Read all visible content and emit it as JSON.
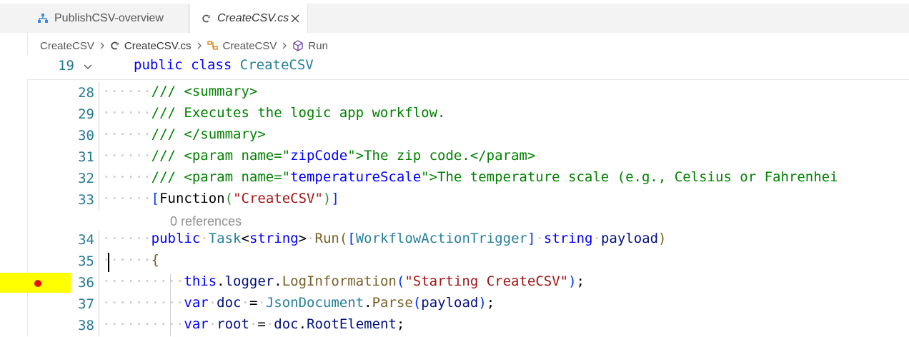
{
  "tabs": [
    {
      "label": "PublishCSV-overview",
      "icon": "workflow-icon",
      "active": false
    },
    {
      "label": "CreateCSV.cs",
      "icon": "csharp-file-icon",
      "active": true
    }
  ],
  "breadcrumb": {
    "project": "CreateCSV",
    "file": "CreateCSV.cs",
    "class": "CreateCSV",
    "method": "Run"
  },
  "sticky_scroll": {
    "line_number": "19",
    "code": "public class CreateCSV"
  },
  "code_lens": {
    "text": "0 references"
  },
  "lines": [
    {
      "n": "28"
    },
    {
      "n": "29"
    },
    {
      "n": "30"
    },
    {
      "n": "31"
    },
    {
      "n": "32"
    },
    {
      "n": "33"
    },
    {
      "n": "34"
    },
    {
      "n": "35"
    },
    {
      "n": "36"
    },
    {
      "n": "37"
    },
    {
      "n": "38"
    }
  ],
  "code_text": {
    "l28": "/// <summary>",
    "l29": "/// Executes the logic app workflow.",
    "l30": "/// </summary>",
    "l31a": "/// <param name=\"",
    "l31b": "zipCode",
    "l31c": "\">The zip code.</param>",
    "l32a": "/// <param name=\"",
    "l32b": "temperatureScale",
    "l32c": "\">The temperature scale (e.g., Celsius or Fahrenhei",
    "l33a": "Function",
    "l33b": "\"CreateCSV\"",
    "l34a": "public",
    "l34b": "Task",
    "l34c": "string",
    "l34d": "Run",
    "l34e": "WorkflowActionTrigger",
    "l34f": "string",
    "l34g": "payload",
    "l36a": "this",
    "l36b": "logger",
    "l36c": "LogInformation",
    "l36d": "\"Starting CreateCSV\"",
    "l37a": "var",
    "l37b": "doc",
    "l37c": "JsonDocument",
    "l37d": "Parse",
    "l37e": "payload",
    "l38a": "var",
    "l38b": "root",
    "l38c": "doc",
    "l38d": "RootElement"
  },
  "colors": {
    "breakpoint": "#e51400",
    "highlight": "#ffff00",
    "line_number": "#237893",
    "comment": "#008000",
    "keyword": "#0000ff",
    "type": "#267f99",
    "string": "#a31515"
  }
}
